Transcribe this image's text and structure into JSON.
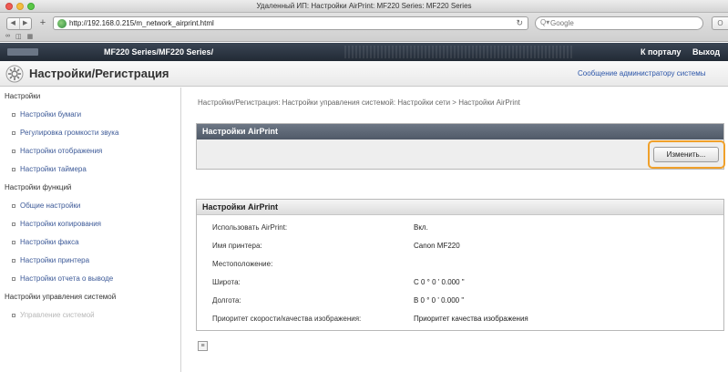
{
  "browser": {
    "window_title": "Удаленный ИП: Настройки AirPrint: MF220 Series: MF220 Series",
    "url": "http://192.168.0.215/m_network_airprint.html",
    "search_placeholder": "Google"
  },
  "header": {
    "device_name": "MF220 Series/MF220 Series/",
    "portal_link": "К порталу",
    "logout_link": "Выход"
  },
  "page": {
    "title": "Настройки/Регистрация",
    "admin_link": "Сообщение администратору системы"
  },
  "sidebar": {
    "sections": [
      {
        "label": "Настройки",
        "items": [
          "Настройки бумаги",
          "Регулировка громкости звука",
          "Настройки отображения",
          "Настройки таймера"
        ]
      },
      {
        "label": "Настройки функций",
        "items": [
          "Общие настройки",
          "Настройки копирования",
          "Настройки факса",
          "Настройки принтера",
          "Настройки отчета о выводе"
        ]
      },
      {
        "label": "Настройки управления системой",
        "items": [
          "Управление системой"
        ]
      }
    ]
  },
  "main": {
    "breadcrumb": "Настройки/Регистрация: Настройки управления системой: Настройки сети > Настройки AirPrint",
    "panel1_title": "Настройки AirPrint",
    "edit_button": "Изменить...",
    "panel2_title": "Настройки AirPrint",
    "rows": [
      {
        "label": "Использовать AirPrint:",
        "value": "Вкл."
      },
      {
        "label": "Имя принтера:",
        "value": "Canon MF220"
      },
      {
        "label": "Местоположение:",
        "value": ""
      },
      {
        "label": "Широта:",
        "value": "С 0 ° 0 ' 0.000 \""
      },
      {
        "label": "Долгота:",
        "value": "В 0 ° 0 ' 0.000 \""
      },
      {
        "label": "Приоритет скорости/качества изображения:",
        "value": "Приоритет качества изображения"
      }
    ]
  },
  "colors": {
    "header_dark": "#2b3440",
    "panel_head": "#5e6876",
    "highlight_orange": "#f0a02a",
    "link_blue": "#3d5a98"
  }
}
